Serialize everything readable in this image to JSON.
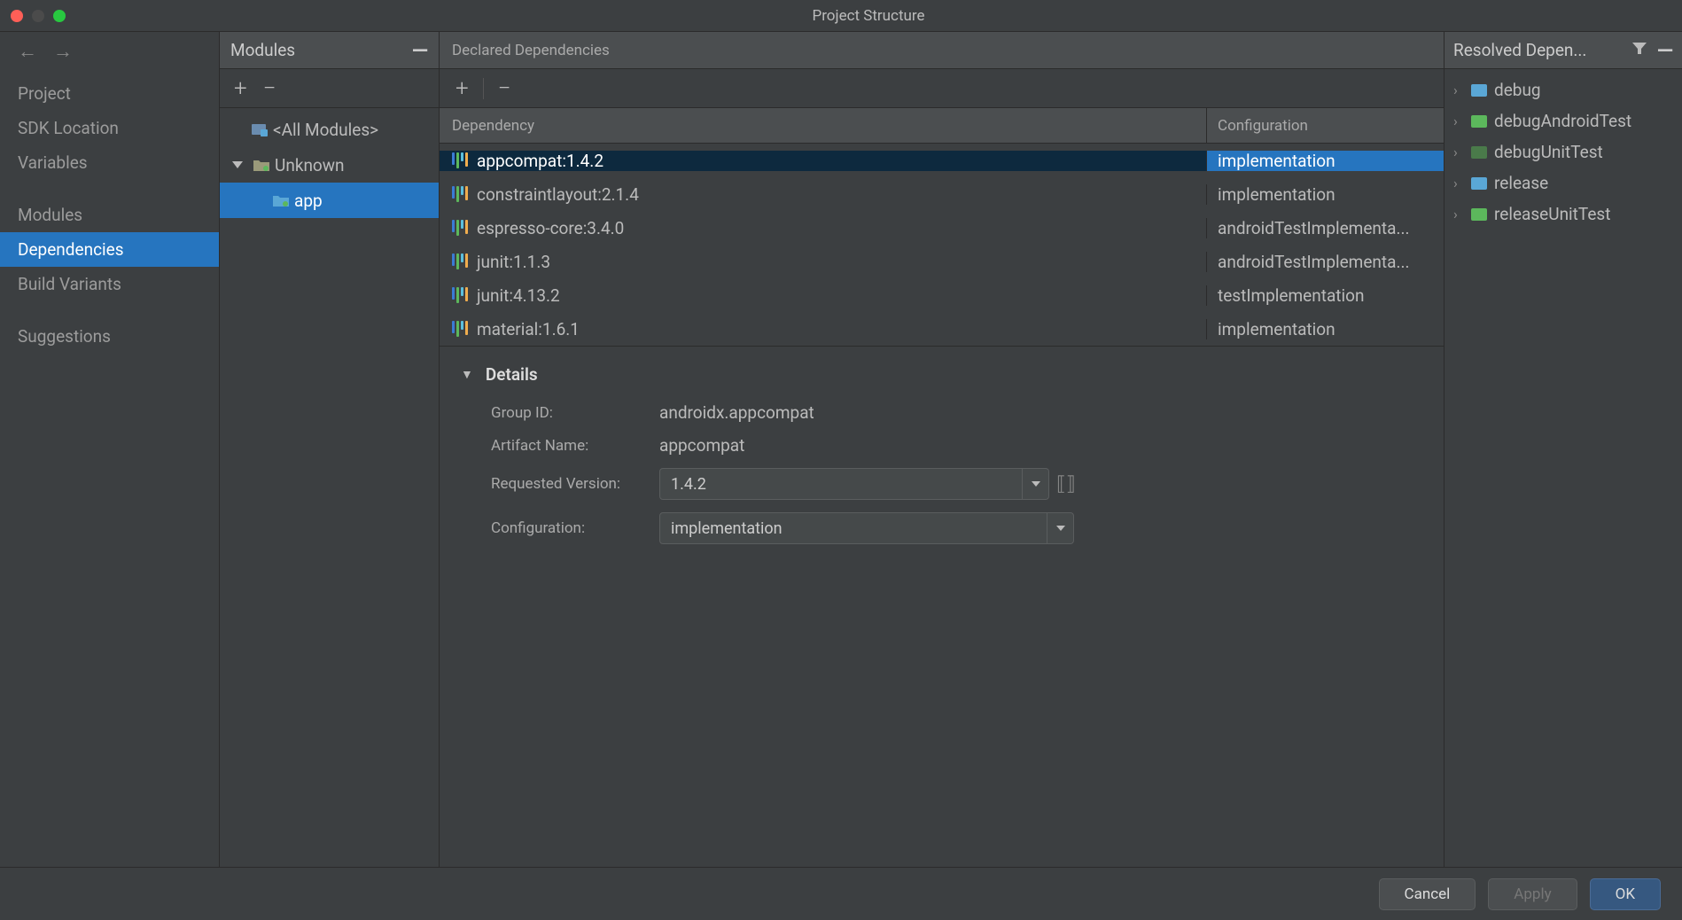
{
  "titlebar": {
    "title": "Project Structure"
  },
  "nav": {
    "items": [
      "Project",
      "SDK Location",
      "Variables",
      "Modules",
      "Dependencies",
      "Build Variants",
      "Suggestions"
    ],
    "selected": "Dependencies"
  },
  "modules": {
    "header": "Modules",
    "allModules": "<All Modules>",
    "unknown": "Unknown",
    "app": "app"
  },
  "declared": {
    "header": "Declared Dependencies",
    "col1": "Dependency",
    "col2": "Configuration",
    "rows": [
      {
        "name": "appcompat:1.4.2",
        "config": "implementation",
        "selected": true
      },
      {
        "name": "constraintlayout:2.1.4",
        "config": "implementation"
      },
      {
        "name": "espresso-core:3.4.0",
        "config": "androidTestImplementa..."
      },
      {
        "name": "junit:1.1.3",
        "config": "androidTestImplementa..."
      },
      {
        "name": "junit:4.13.2",
        "config": "testImplementation"
      },
      {
        "name": "material:1.6.1",
        "config": "implementation"
      }
    ]
  },
  "details": {
    "title": "Details",
    "groupIdLabel": "Group ID:",
    "groupId": "androidx.appcompat",
    "artifactLabel": "Artifact Name:",
    "artifact": "appcompat",
    "versionLabel": "Requested Version:",
    "version": "1.4.2",
    "configLabel": "Configuration:",
    "config": "implementation"
  },
  "resolved": {
    "header": "Resolved Depen...",
    "items": [
      {
        "label": "debug",
        "color": "blue"
      },
      {
        "label": "debugAndroidTest",
        "color": "green"
      },
      {
        "label": "debugUnitTest",
        "color": "dark-green"
      },
      {
        "label": "release",
        "color": "blue"
      },
      {
        "label": "releaseUnitTest",
        "color": "green"
      }
    ]
  },
  "footer": {
    "cancel": "Cancel",
    "apply": "Apply",
    "ok": "OK"
  }
}
